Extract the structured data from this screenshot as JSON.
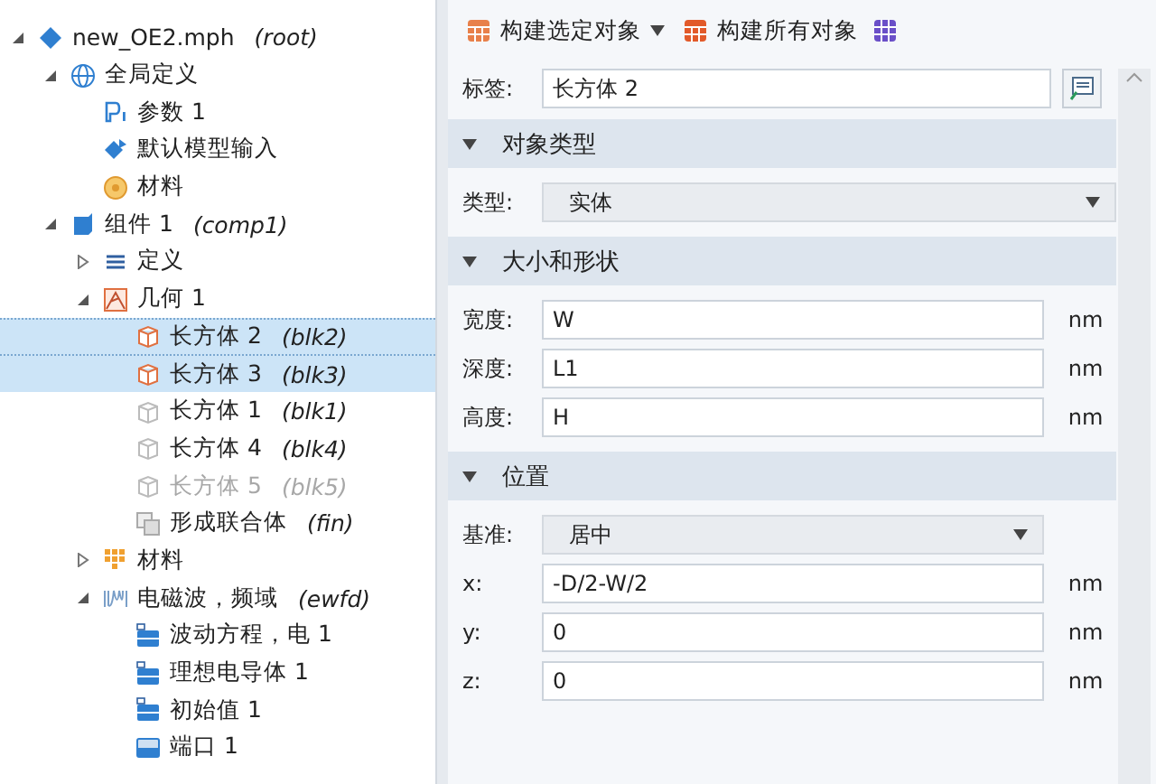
{
  "tree": [
    {
      "label": "new_OE2.mph",
      "tag": "(root)",
      "kind": "model",
      "expanded": true,
      "selected": false,
      "disabled": false,
      "children": [
        {
          "label": "全局定义",
          "kind": "globe",
          "expanded": true,
          "selected": false,
          "disabled": false,
          "children": [
            {
              "label": "参数 1",
              "kind": "param",
              "selected": false,
              "disabled": false
            },
            {
              "label": "默认模型输入",
              "kind": "input",
              "selected": false,
              "disabled": false
            },
            {
              "label": "材料",
              "kind": "material",
              "selected": false,
              "disabled": false
            }
          ]
        },
        {
          "label": "组件 1",
          "tag": "(comp1)",
          "kind": "component",
          "expanded": true,
          "selected": false,
          "disabled": false,
          "children": [
            {
              "label": "定义",
              "kind": "defs",
              "expanded": false,
              "selected": false,
              "disabled": false
            },
            {
              "label": "几何 1",
              "kind": "geometry",
              "expanded": true,
              "selected": false,
              "disabled": false,
              "children": [
                {
                  "label": "长方体 2",
                  "tag": "(blk2)",
                  "kind": "block",
                  "selected": true,
                  "disabled": false
                },
                {
                  "label": "长方体 3",
                  "tag": "(blk3)",
                  "kind": "block",
                  "selected": true,
                  "disabled": false
                },
                {
                  "label": "长方体 1",
                  "tag": "(blk1)",
                  "kind": "block",
                  "selected": false,
                  "disabled": false
                },
                {
                  "label": "长方体 4",
                  "tag": "(blk4)",
                  "kind": "block",
                  "selected": false,
                  "disabled": false
                },
                {
                  "label": "长方体 5",
                  "tag": "(blk5)",
                  "kind": "block",
                  "selected": false,
                  "disabled": true
                },
                {
                  "label": "形成联合体",
                  "tag": "(fin)",
                  "kind": "union",
                  "selected": false,
                  "disabled": false
                }
              ]
            },
            {
              "label": "材料",
              "kind": "materials",
              "expanded": false,
              "selected": false,
              "disabled": false
            },
            {
              "label": "电磁波，频域",
              "tag": "(ewfd)",
              "kind": "physics",
              "expanded": true,
              "selected": false,
              "disabled": false,
              "children": [
                {
                  "label": "波动方程，电 1",
                  "kind": "domain",
                  "selected": false,
                  "disabled": false
                },
                {
                  "label": "理想电导体 1",
                  "kind": "domain",
                  "selected": false,
                  "disabled": false
                },
                {
                  "label": "初始值 1",
                  "kind": "domain",
                  "selected": false,
                  "disabled": false
                },
                {
                  "label": "端口 1",
                  "kind": "boundary",
                  "selected": false,
                  "disabled": false
                }
              ]
            }
          ]
        }
      ]
    }
  ],
  "toolbar": [
    {
      "kind": "split",
      "label": "构建选定对象"
    },
    {
      "kind": "button",
      "label": "构建所有对象"
    },
    {
      "kind": "icon"
    }
  ],
  "label_field": {
    "label": "标签:",
    "value": "长方体 2"
  },
  "sections": [
    {
      "title": "对象类型",
      "expanded": true,
      "rows": [
        {
          "kind": "select",
          "label": "类型:",
          "value": "实体"
        }
      ]
    },
    {
      "title": "大小和形状",
      "expanded": true,
      "rows": [
        {
          "kind": "field",
          "label": "宽度:",
          "value": "W",
          "unit": "nm"
        },
        {
          "kind": "field",
          "label": "深度:",
          "value": "L1",
          "unit": "nm"
        },
        {
          "kind": "field",
          "label": "高度:",
          "value": "H",
          "unit": "nm"
        }
      ]
    },
    {
      "title": "位置",
      "expanded": true,
      "rows": [
        {
          "kind": "select",
          "label": "基准:",
          "value": "居中"
        },
        {
          "kind": "field",
          "label": "x:",
          "value": "-D/2-W/2",
          "unit": "nm"
        },
        {
          "kind": "field",
          "label": "y:",
          "value": "0",
          "unit": "nm"
        },
        {
          "kind": "field",
          "label": "z:",
          "value": "0",
          "unit": "nm"
        }
      ]
    }
  ]
}
